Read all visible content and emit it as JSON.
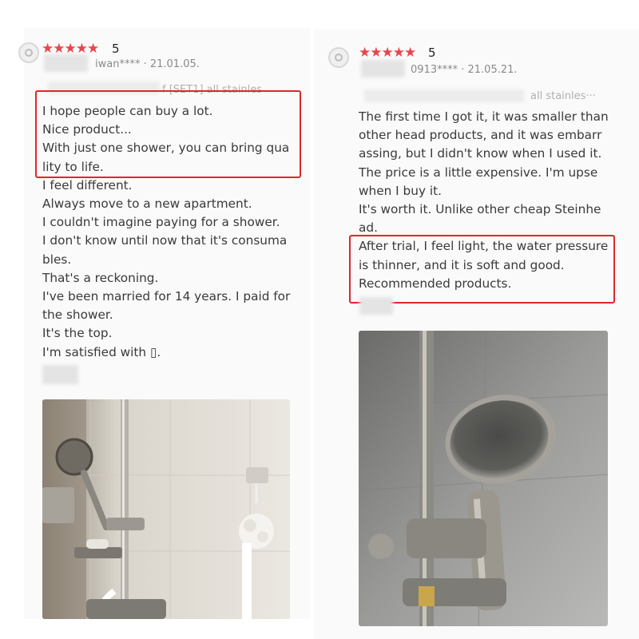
{
  "reviews": [
    {
      "rating_stars": "★★★★★",
      "rating_value": "5",
      "username": "iwan****",
      "date": "21.01.05.",
      "option_text": "f [SET1] all stainles",
      "text_lines": [
        "I hope people can buy a lot.",
        "Nice product...",
        "With just one shower, you can bring qua",
        "lity to life.",
        "I feel different.",
        "Always move to a new apartment.",
        "I couldn't imagine paying for a shower.",
        "I don't know until now that it's consuma",
        "bles.",
        "That's a reckoning.",
        "I've been married for 14 years. I paid for",
        " the shower.",
        "It's the top.",
        "I'm satisfied with ▯."
      ],
      "highlight_color": "#e0262b",
      "photo": {
        "description_icon": "shower-photo-white-tile"
      }
    },
    {
      "rating_stars": "★★★★★",
      "rating_value": "5",
      "username": "0913****",
      "date": "21.05.21.",
      "option_text": "all stainles···",
      "text_lines": [
        "The first time I got it, it was smaller than",
        " other head products, and it was embarr",
        "assing, but I didn't know when I used it.",
        "The price is a little expensive. I'm upse",
        " when I buy it.",
        "It's worth it. Unlike other cheap Steinhe",
        "ad.",
        "After trial, I feel light, the water pressure",
        " is thinner, and it is soft and good.",
        "Recommended products."
      ],
      "highlight_color": "#e0262b",
      "photo": {
        "description_icon": "shower-photo-grey-tile"
      }
    }
  ]
}
